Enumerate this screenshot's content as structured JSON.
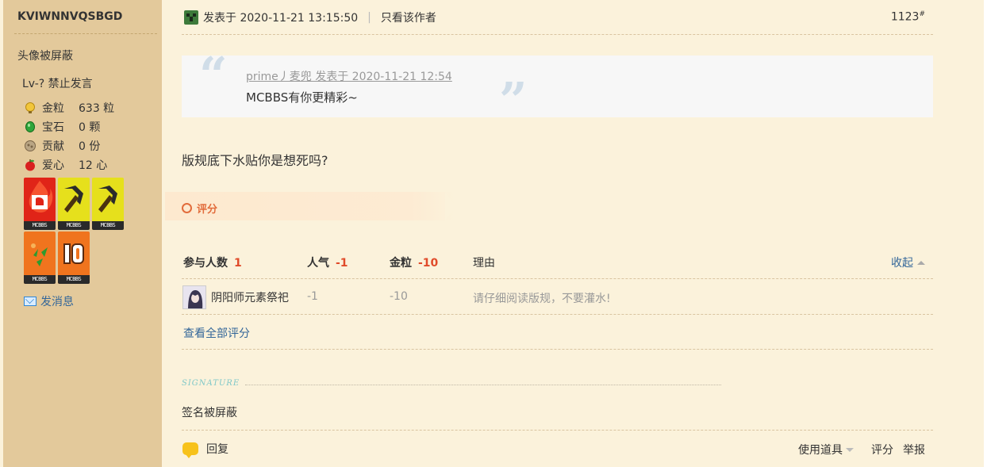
{
  "author": {
    "name": "KVIWNNVQSBGD",
    "avatar_text": "头像被屏蔽",
    "level": "Lv-? 禁止发言",
    "stats": [
      {
        "label": "金粒",
        "value": "633 粒",
        "icon": "gold-nugget-icon",
        "color": "#e8b824"
      },
      {
        "label": "宝石",
        "value": "0 颗",
        "icon": "emerald-icon",
        "color": "#2fa53a"
      },
      {
        "label": "贡献",
        "value": "0 份",
        "icon": "contribution-icon",
        "color": "#a08a6a"
      },
      {
        "label": "爱心",
        "value": "12 心",
        "icon": "apple-heart-icon",
        "color": "#d92020"
      }
    ],
    "medal_caption": "MCBBS",
    "send_message": "发消息"
  },
  "post": {
    "posted_at": "发表于 2020-11-21 13:15:50",
    "only_author": "只看该作者",
    "floor": "1123",
    "floor_mark": "#",
    "quote_meta": "prime丿麦兜 发表于 2020-11-21 12:54",
    "quote_text": "MCBBS有你更精彩~",
    "body": "版规底下水贴你是想死吗?"
  },
  "rating": {
    "title": "评分",
    "headers": {
      "participants_label": "参与人数",
      "participants_value": "1",
      "popularity_label": "人气",
      "popularity_value": "-1",
      "gold_label": "金粒",
      "gold_value": "-10",
      "reason_label": "理由"
    },
    "collapse": "收起",
    "rows": [
      {
        "user": "阴阳师元素祭祀",
        "popularity": "-1",
        "gold": "-10",
        "reason": "请仔细阅读版规，不要灌水!"
      }
    ],
    "view_all": "查看全部评分"
  },
  "signature": {
    "label": "SIGNATURE",
    "text": "签名被屏蔽"
  },
  "footer": {
    "reply": "回复",
    "tools": "使用道具",
    "rate": "评分",
    "report": "举报"
  }
}
